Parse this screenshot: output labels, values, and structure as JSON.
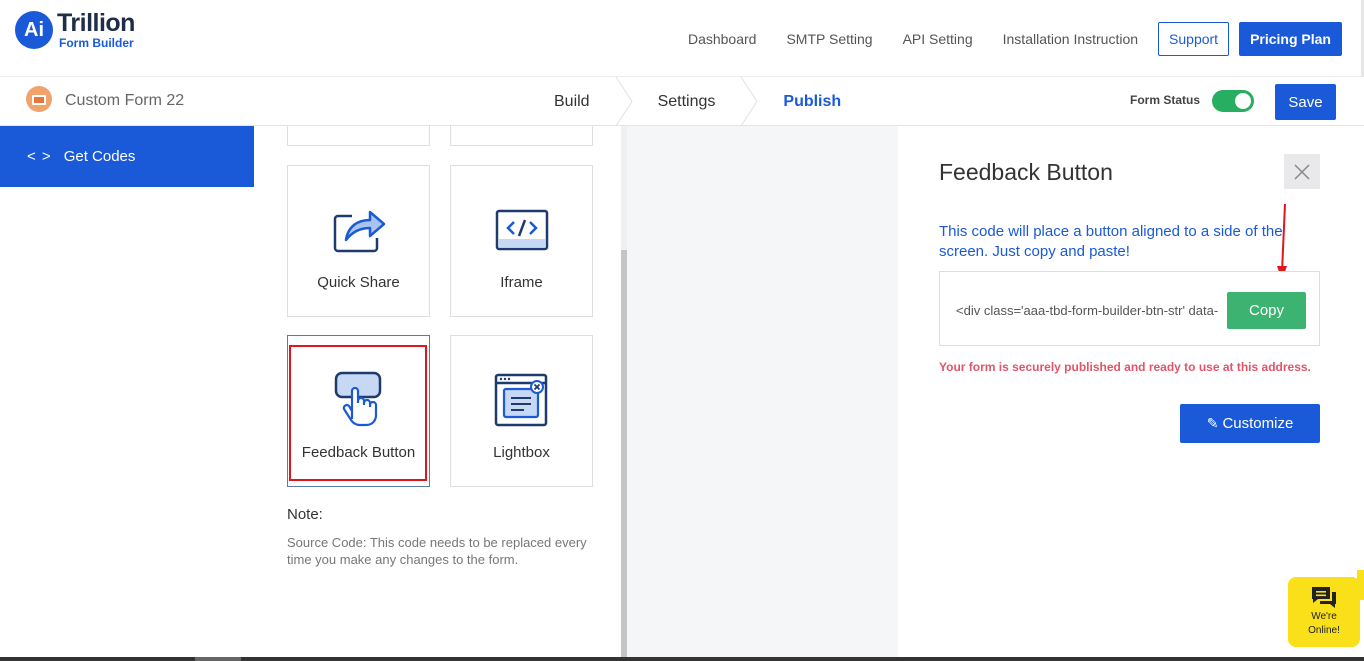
{
  "brand": {
    "logo_mark": "Ai",
    "name": "Trillion",
    "sub": "Form Builder"
  },
  "nav": {
    "links": [
      "Dashboard",
      "SMTP Setting",
      "API Setting",
      "Installation Instruction"
    ],
    "support": "Support",
    "pricing": "Pricing Plan"
  },
  "form": {
    "title": "Custom Form 22",
    "steps": [
      "Build",
      "Settings",
      "Publish"
    ],
    "active_step": "Publish",
    "status_label": "Form Status",
    "status_on": true,
    "save": "Save"
  },
  "sidebar": {
    "items": [
      {
        "label": "Get Codes",
        "icon": "code-icon"
      }
    ]
  },
  "tiles": [
    {
      "label": "Quick Share",
      "icon": "share-icon"
    },
    {
      "label": "Iframe",
      "icon": "iframe-code-icon"
    },
    {
      "label": "Feedback Button",
      "icon": "hand-click-icon"
    },
    {
      "label": "Lightbox",
      "icon": "lightbox-window-icon"
    }
  ],
  "note": {
    "title": "Note:",
    "text": "Source Code: This code needs to be replaced every time you make any changes to the form."
  },
  "panel": {
    "title": "Feedback Button",
    "description": "This code will place a button aligned to a side of the screen. Just copy and paste!",
    "code": "<div class='aaa-tbd-form-builder-btn-str' data-",
    "copy": "Copy",
    "message": "Your form is securely published and ready to use at this address.",
    "customize": "Customize"
  },
  "chat": {
    "line1": "We're",
    "line2": "Online!"
  },
  "colors": {
    "primary": "#1a5ad8",
    "success": "#3cb371",
    "toggle": "#27ae60",
    "alert": "#e0556b",
    "chat": "#f9e019"
  }
}
